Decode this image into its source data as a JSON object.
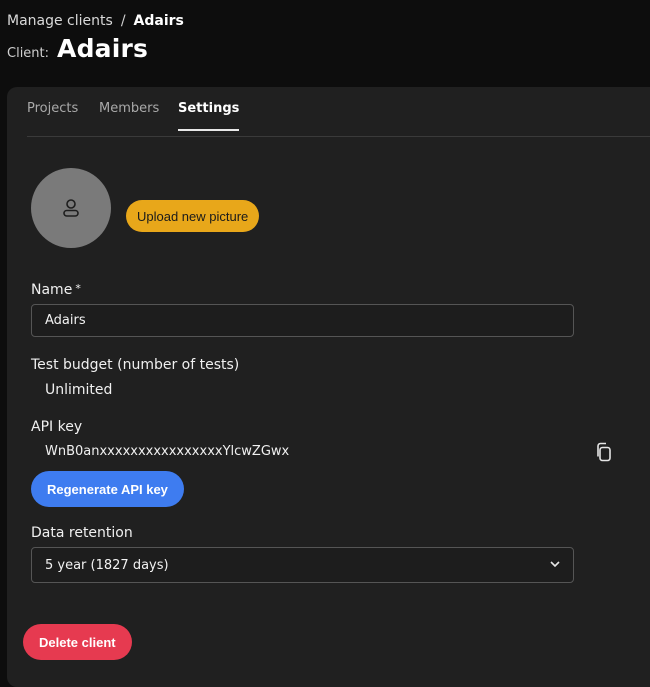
{
  "breadcrumb": {
    "parent": "Manage clients",
    "separator": "/",
    "current": "Adairs"
  },
  "header": {
    "client_label": "Client:",
    "client_name": "Adairs"
  },
  "tabs": [
    {
      "label": "Projects",
      "active": false
    },
    {
      "label": "Members",
      "active": false
    },
    {
      "label": "Settings",
      "active": true
    }
  ],
  "settings": {
    "avatar_icon": "user-icon",
    "upload_label": "Upload new picture",
    "name_label": "Name",
    "name_required_mark": "*",
    "name_value": "Adairs",
    "budget_label": "Test budget (number of tests)",
    "budget_value": "Unlimited",
    "api_key_label": "API key",
    "api_key_value": "WnB0anxxxxxxxxxxxxxxxxYlcwZGwx",
    "copy_icon": "copy-icon",
    "regenerate_label": "Regenerate API key",
    "retention_label": "Data retention",
    "retention_value": "5 year (1827 days)",
    "delete_label": "Delete client"
  },
  "colors": {
    "upload_button": "#e8a71a",
    "regenerate_button": "#3e7cf0",
    "delete_button": "#e63a50",
    "panel": "#202020",
    "background": "#0d0d0d"
  }
}
